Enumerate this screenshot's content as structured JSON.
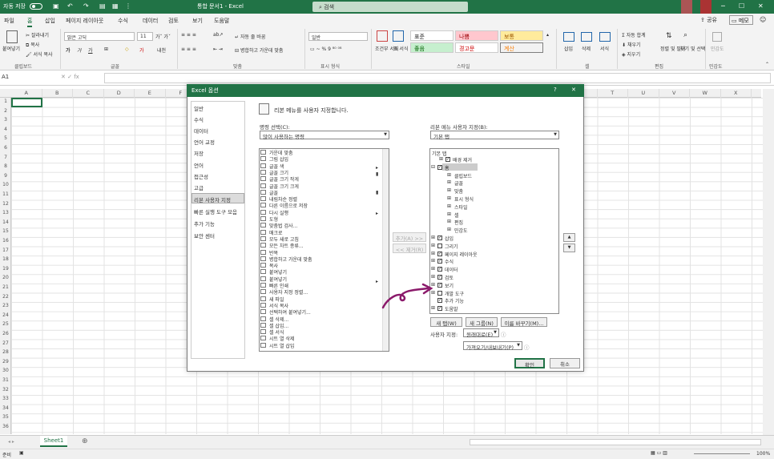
{
  "titlebar": {
    "autosave": "자동 저장",
    "title": "통합 문서1 - Excel",
    "search": "검색"
  },
  "menu": {
    "items": [
      "파일",
      "홈",
      "삽입",
      "페이지 레이아웃",
      "수식",
      "데이터",
      "검토",
      "보기",
      "도움말"
    ],
    "share": "공유",
    "memo": "메모"
  },
  "ribbon": {
    "clipboard": {
      "paste": "붙여넣기",
      "cut": "잘라내기",
      "copy": "복사",
      "format_painter": "서식 복사",
      "group": "클립보드"
    },
    "font": {
      "name": "맑은 고딕",
      "size": "11",
      "group": "글꼴"
    },
    "alignment": {
      "wrap": "자동 줄 바꿈",
      "merge": "병합하고 가운데 맞춤",
      "group": "맞춤"
    },
    "number": {
      "format": "일반",
      "group": "표시 형식"
    },
    "styles": {
      "cond": "조건부 서식",
      "table": "표 서식",
      "normal": "표준",
      "bad": "나쁨",
      "neutral": "보통",
      "good": "좋음",
      "warning": "경고문",
      "calc": "계산",
      "group": "스타일"
    },
    "cells": {
      "insert": "삽입",
      "delete": "삭제",
      "format": "서식",
      "group": "셀"
    },
    "editing": {
      "autosum": "자동 합계",
      "fill": "채우기",
      "clear": "지우기",
      "sort": "정렬 및 필터",
      "find": "찾기 및 선택",
      "group": "편집"
    },
    "sensitivity": {
      "label": "민감도",
      "group": "민감도"
    }
  },
  "formula": {
    "namebox": "A1",
    "fx": "fx"
  },
  "columns": [
    "A",
    "B",
    "C",
    "D",
    "E",
    "F",
    "G",
    "H",
    "I",
    "J",
    "K",
    "L",
    "M",
    "N",
    "O",
    "P",
    "Q",
    "R",
    "S",
    "T",
    "U",
    "V",
    "W",
    "X"
  ],
  "rows": [
    "1",
    "2",
    "3",
    "4",
    "5",
    "6",
    "7",
    "8",
    "9",
    "10",
    "11",
    "12",
    "13",
    "14",
    "15",
    "16",
    "17",
    "18",
    "19",
    "20",
    "21",
    "22",
    "23",
    "24",
    "25",
    "26",
    "27",
    "28",
    "29",
    "30",
    "31",
    "32",
    "33",
    "34",
    "35",
    "36"
  ],
  "sheet": {
    "tab": "Sheet1",
    "add": "⊕"
  },
  "status": {
    "ready": "준비",
    "zoom": "100%"
  },
  "dialog": {
    "title": "Excel 옵션",
    "help": "?",
    "close": "✕",
    "nav": [
      "일반",
      "수식",
      "데이터",
      "언어 교정",
      "저장",
      "언어",
      "접근성",
      "고급",
      "리본 사용자 지정",
      "빠른 실행 도구 모음",
      "추가 기능",
      "보안 센터"
    ],
    "heading": "리본 메뉴를 사용자 지정합니다.",
    "choose_label": "명령 선택(C):",
    "choose_value": "많이 사용하는 명령",
    "customize_label": "리본 메뉴 사용자 지정(B):",
    "customize_value": "기본 탭",
    "commands": [
      "가운데 맞춤",
      "그림 삽입",
      "글꼴 색",
      "글꼴 크기",
      "글꼴 크기 작게",
      "글꼴 크기 크게",
      "글꼴",
      "내림차순 정렬",
      "다른 이름으로 저장",
      "다시 실행",
      "도형",
      "맞춤법 검사...",
      "매크로",
      "모두 새로 고침",
      "모든 차트 종류...",
      "반복",
      "병합하고 가운데 맞춤",
      "복사",
      "붙여넣기",
      "붙여넣기",
      "빠른 인쇄",
      "사용자 지정 정렬...",
      "새 파일",
      "서식 복사",
      "선택하여 붙여넣기...",
      "셀 삭제...",
      "셀 삽입...",
      "셀 서식",
      "시트 열 삭제",
      "시트 열 삽입"
    ],
    "tabs_header": "기본 탭",
    "tabs": [
      {
        "label": "배경 제거",
        "level": 1,
        "expand": "⊞",
        "checked": true
      },
      {
        "label": "홈",
        "level": 0,
        "expand": "⊟",
        "checked": true,
        "selected": true
      },
      {
        "label": "클립보드",
        "level": 2,
        "expand": "⊞"
      },
      {
        "label": "글꼴",
        "level": 2,
        "expand": "⊞"
      },
      {
        "label": "맞춤",
        "level": 2,
        "expand": "⊞"
      },
      {
        "label": "표시 형식",
        "level": 2,
        "expand": "⊞"
      },
      {
        "label": "스타일",
        "level": 2,
        "expand": "⊞"
      },
      {
        "label": "셀",
        "level": 2,
        "expand": "⊞"
      },
      {
        "label": "편집",
        "level": 2,
        "expand": "⊞"
      },
      {
        "label": "민감도",
        "level": 2,
        "expand": "⊞"
      },
      {
        "label": "삽입",
        "level": 0,
        "expand": "⊞",
        "checked": true
      },
      {
        "label": "그리기",
        "level": 0,
        "expand": "⊞",
        "checked": false
      },
      {
        "label": "페이지 레이아웃",
        "level": 0,
        "expand": "⊞",
        "checked": true
      },
      {
        "label": "수식",
        "level": 0,
        "expand": "⊞",
        "checked": true
      },
      {
        "label": "데이터",
        "level": 0,
        "expand": "⊞",
        "checked": true
      },
      {
        "label": "검토",
        "level": 0,
        "expand": "⊞",
        "checked": true
      },
      {
        "label": "보기",
        "level": 0,
        "expand": "⊞",
        "checked": true
      },
      {
        "label": "개발 도구",
        "level": 0,
        "expand": "⊞",
        "checked": false
      },
      {
        "label": "추가 기능",
        "level": 0,
        "expand": "",
        "checked": true
      },
      {
        "label": "도움말",
        "level": 0,
        "expand": "⊞",
        "checked": true
      }
    ],
    "add_btn": "추가(A) >>",
    "remove_btn": "<< 제거(R)",
    "new_tab": "새 탭(W)",
    "new_group": "새 그룹(N)",
    "rename": "이름 바꾸기(M)...",
    "custom_label": "사용자 지정:",
    "reset": "원래대로(E)",
    "import_export": "가져오기/내보내기(P)",
    "ok": "확인",
    "cancel": "취소"
  }
}
